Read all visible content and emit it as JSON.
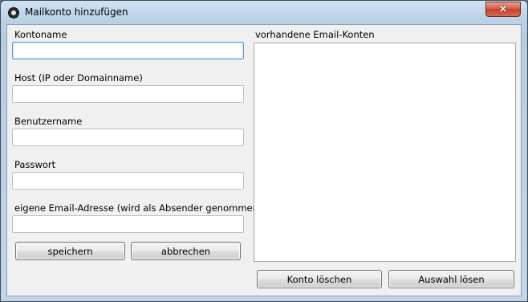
{
  "window": {
    "title": "Mailkonto hinzufügen",
    "close_label": "×"
  },
  "form": {
    "account_name": {
      "label": "Kontoname",
      "value": ""
    },
    "host": {
      "label": "Host (IP oder Domainname)",
      "value": ""
    },
    "username": {
      "label": "Benutzername",
      "value": ""
    },
    "password": {
      "label": "Passwort",
      "value": ""
    },
    "sender_email": {
      "label": "eigene Email-Adresse (wird als Absender genommen)",
      "value": ""
    },
    "save_label": "speichern",
    "cancel_label": "abbrechen"
  },
  "accounts": {
    "label": "vorhandene Email-Konten",
    "items": [],
    "delete_label": "Konto löschen",
    "clear_selection_label": "Auswahl lösen"
  }
}
